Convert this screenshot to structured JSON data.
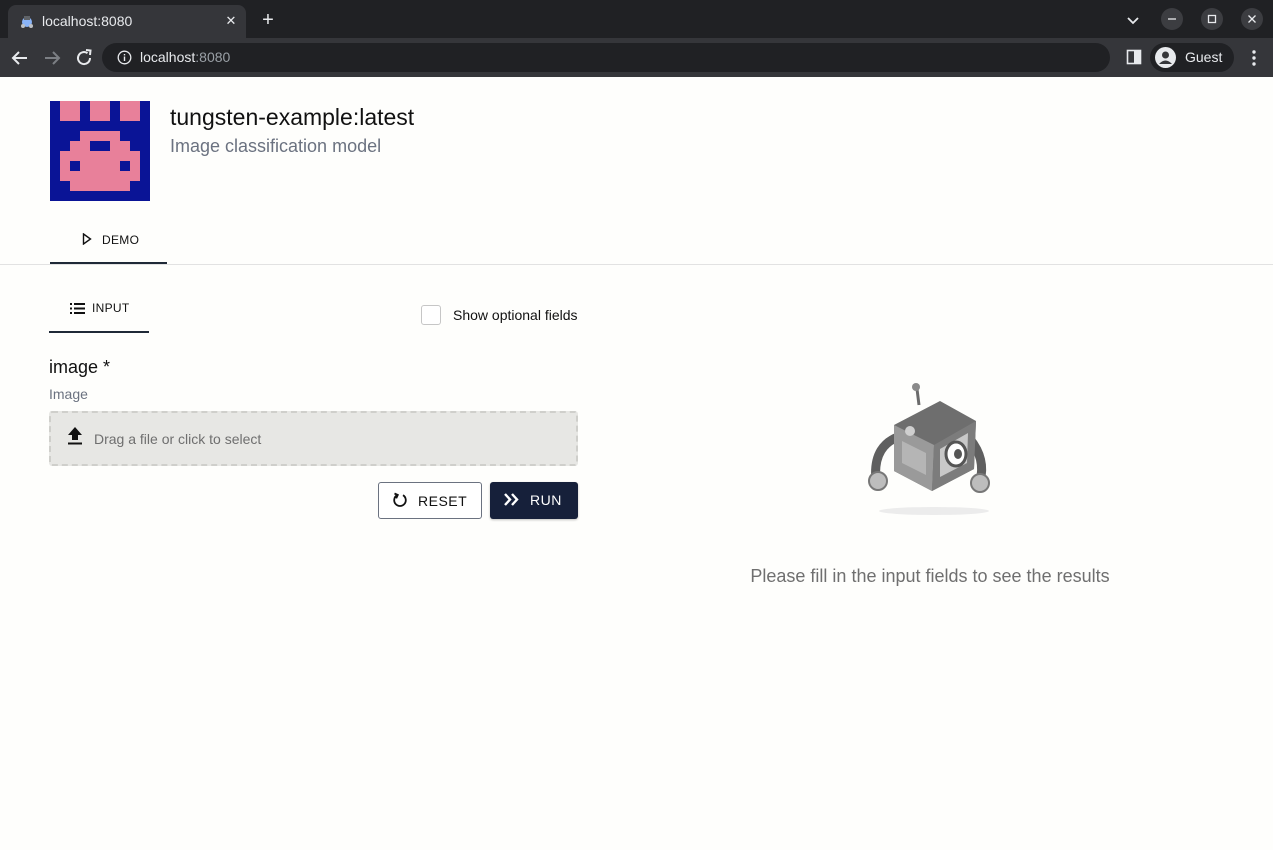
{
  "browser": {
    "tab_title": "localhost:8080",
    "url_host": "localhost",
    "url_port": ":8080",
    "profile_label": "Guest"
  },
  "app": {
    "title": "tungsten-example:latest",
    "subtitle": "Image classification model",
    "demo_tab_label": "DEMO"
  },
  "form": {
    "input_tab_label": "INPUT",
    "show_optional_label": "Show optional fields",
    "show_optional_checked": false,
    "field_label": "image *",
    "field_type": "Image",
    "dropzone_text": "Drag a file or click to select",
    "reset_label": "RESET",
    "run_label": "RUN"
  },
  "results": {
    "empty_message": "Please fill in the input fields to see the results"
  },
  "colors": {
    "logo_bg": "#0a1496",
    "logo_fg": "#e8809a",
    "primary_button": "#16203a"
  }
}
